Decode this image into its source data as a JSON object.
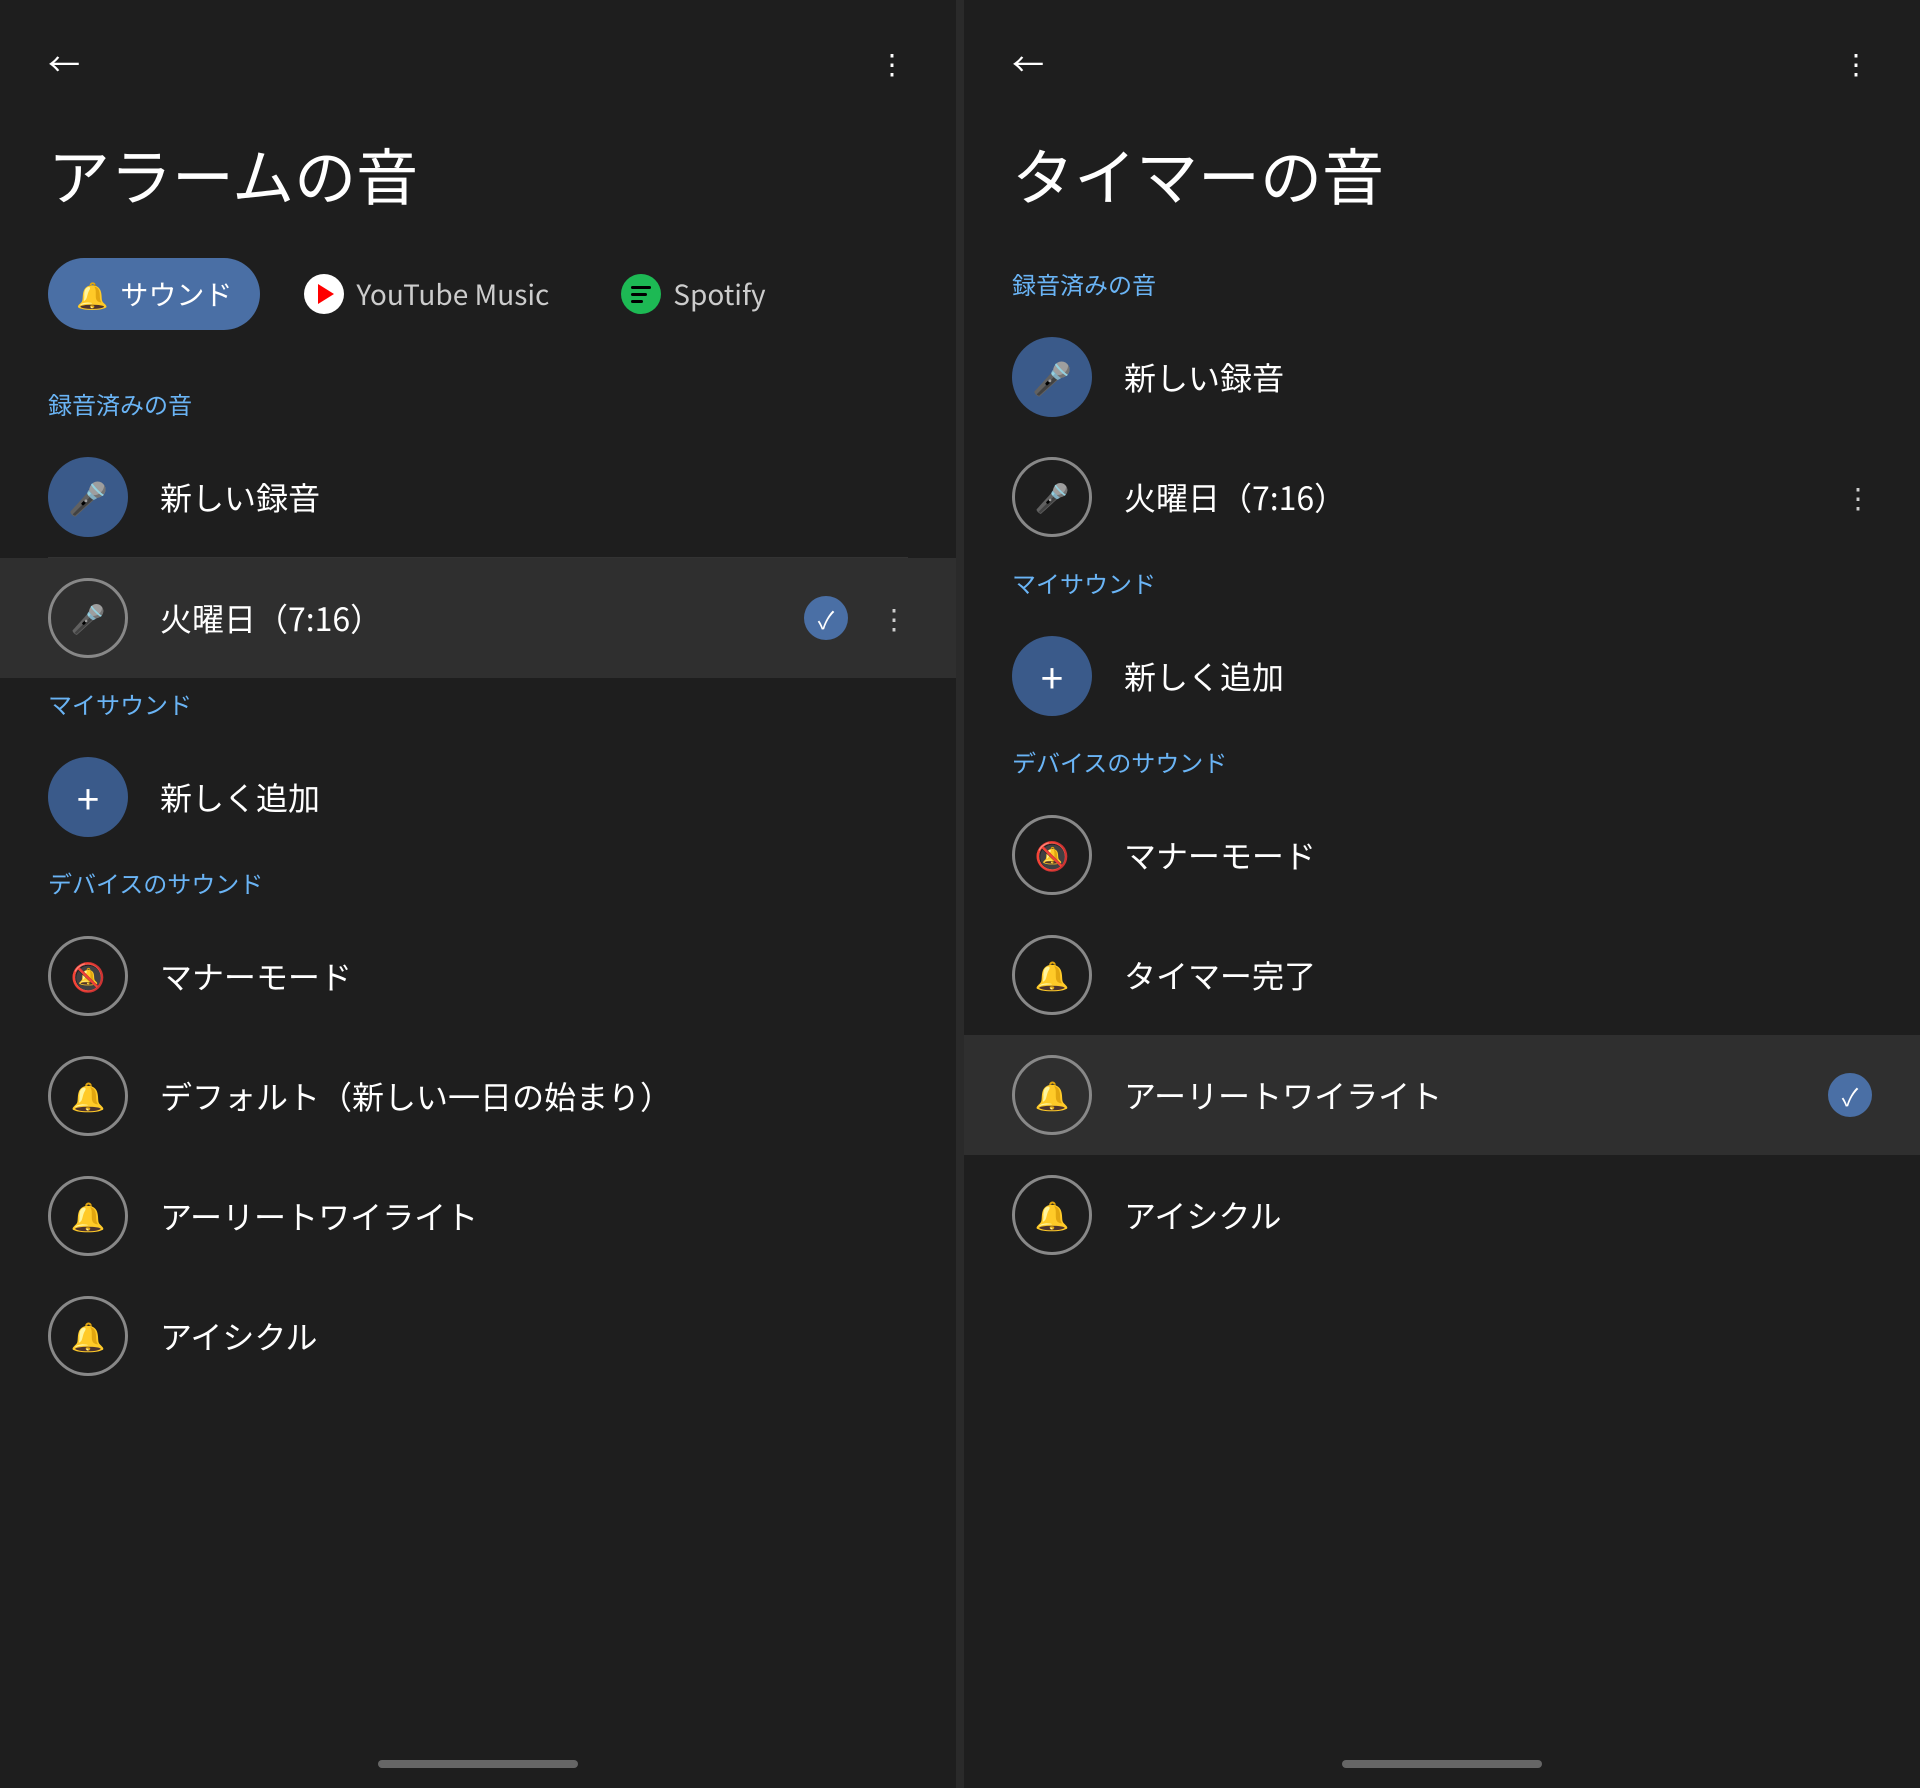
{
  "left": {
    "title": "アラームの音",
    "tabs": [
      {
        "id": "sound",
        "label": "サウンド",
        "type": "bell",
        "active": true
      },
      {
        "id": "youtube",
        "label": "YouTube Music",
        "type": "youtube",
        "active": false
      },
      {
        "id": "spotify",
        "label": "Spotify",
        "type": "spotify",
        "active": false
      }
    ],
    "sections": [
      {
        "label": "録音済みの音",
        "items": [
          {
            "icon": "mic",
            "text": "新しい録音",
            "selected": false,
            "showMore": false,
            "filled": true
          },
          {
            "icon": "mic",
            "text": "火曜日（7:16）",
            "selected": true,
            "showMore": true,
            "filled": false
          }
        ]
      },
      {
        "label": "マイサウンド",
        "items": [
          {
            "icon": "plus",
            "text": "新しく追加",
            "selected": false,
            "showMore": false,
            "filled": true
          }
        ]
      },
      {
        "label": "デバイスのサウンド",
        "items": [
          {
            "icon": "bell-off",
            "text": "マナーモード",
            "selected": false,
            "showMore": false,
            "filled": false
          },
          {
            "icon": "bell",
            "text": "デフォルト（新しい一日の始まり）",
            "selected": false,
            "showMore": false,
            "filled": false
          },
          {
            "icon": "bell",
            "text": "アーリートワイライト",
            "selected": false,
            "showMore": false,
            "filled": false
          },
          {
            "icon": "bell",
            "text": "アイシクル",
            "selected": false,
            "showMore": false,
            "filled": false
          }
        ]
      }
    ]
  },
  "right": {
    "title": "タイマーの音",
    "sections": [
      {
        "label": "録音済みの音",
        "items": [
          {
            "icon": "mic",
            "text": "新しい録音",
            "selected": false,
            "showMore": false,
            "filled": true
          },
          {
            "icon": "mic",
            "text": "火曜日（7:16）",
            "selected": false,
            "showMore": true,
            "filled": false
          }
        ]
      },
      {
        "label": "マイサウンド",
        "items": [
          {
            "icon": "plus",
            "text": "新しく追加",
            "selected": false,
            "showMore": false,
            "filled": true
          }
        ]
      },
      {
        "label": "デバイスのサウンド",
        "items": [
          {
            "icon": "bell-off",
            "text": "マナーモード",
            "selected": false,
            "showMore": false,
            "filled": false
          },
          {
            "icon": "bell",
            "text": "タイマー完了",
            "selected": false,
            "showMore": false,
            "filled": false
          },
          {
            "icon": "bell",
            "text": "アーリートワイライト",
            "selected": true,
            "showMore": false,
            "filled": false
          },
          {
            "icon": "bell",
            "text": "アイシクル",
            "selected": false,
            "showMore": false,
            "filled": false
          }
        ]
      }
    ]
  },
  "icons": {
    "back": "←",
    "more": "⋮",
    "check": "✓",
    "bell": "🔔",
    "bell_off": "🔕",
    "mic": "🎤",
    "plus": "+"
  }
}
